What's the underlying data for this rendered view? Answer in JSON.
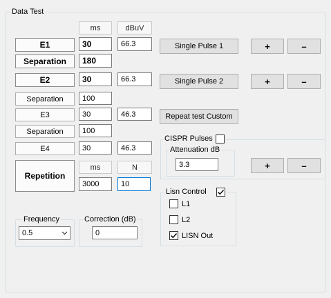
{
  "group_data_test": "Data Test",
  "col_headers": {
    "ms": "ms",
    "dbuv": "dBuV",
    "ms2": "ms",
    "n": "N"
  },
  "rows": {
    "e1": {
      "label": "E1",
      "ms": "30",
      "dbuv": "66.3"
    },
    "sep1": {
      "label": "Separation",
      "ms": "180"
    },
    "e2": {
      "label": "E2",
      "ms": "30",
      "dbuv": "66.3"
    },
    "sep2": {
      "label": "Separation",
      "ms": "100"
    },
    "e3": {
      "label": "E3",
      "ms": "30",
      "dbuv": "46.3"
    },
    "sep3": {
      "label": "Separation",
      "ms": "100"
    },
    "e4": {
      "label": "E4",
      "ms": "30",
      "dbuv": "46.3"
    },
    "repetition": {
      "label": "Repetition",
      "ms": "3000",
      "n": "10"
    }
  },
  "buttons": {
    "single_pulse_1": "Single Pulse 1",
    "single_pulse_2": "Single Pulse 2",
    "repeat_test_custom": "Repeat test Custom",
    "plus": "+",
    "minus": "–"
  },
  "cispr": {
    "label": "CISPR Pulses",
    "checked": false,
    "attenuation_label": "Attenuation dB",
    "attenuation_value": "3.3"
  },
  "lisn": {
    "label": "Lisn Control",
    "checked": true,
    "options": [
      {
        "label": "L1",
        "checked": false
      },
      {
        "label": "L2",
        "checked": false
      },
      {
        "label": "LISN Out",
        "checked": true
      }
    ]
  },
  "frequency": {
    "label": "Frequency",
    "value": "0.5"
  },
  "correction": {
    "label": "Correction (dB)",
    "value": "0"
  }
}
